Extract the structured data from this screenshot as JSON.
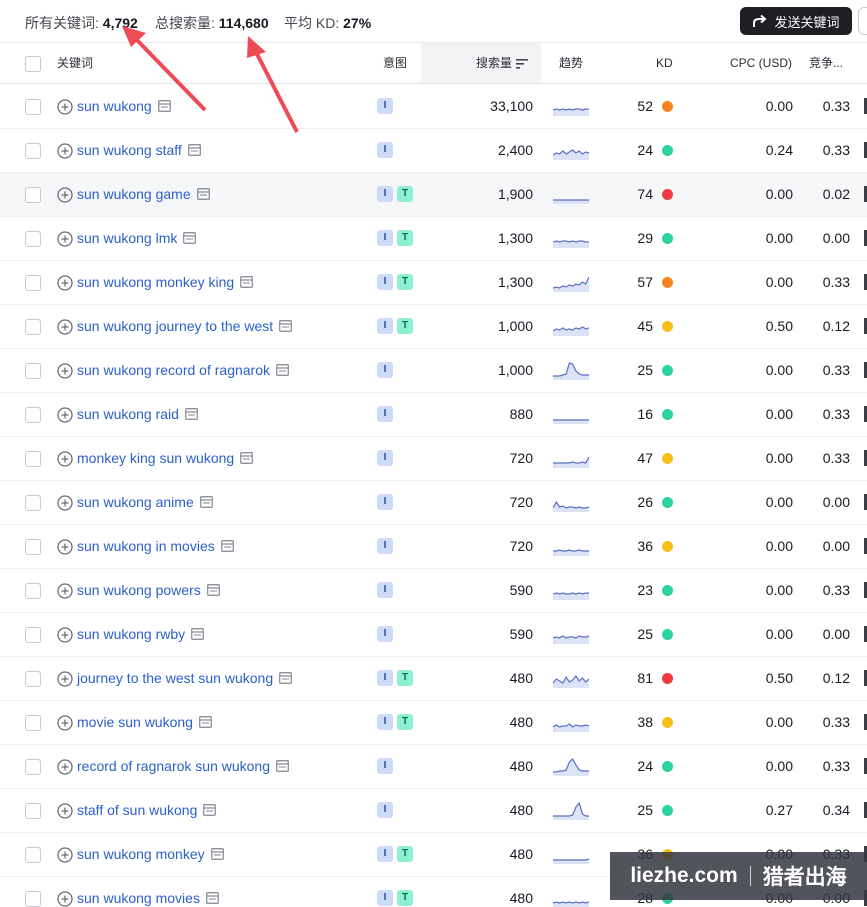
{
  "summary": {
    "all_keywords_label": "所有关键词:",
    "all_keywords_value": "4,792",
    "total_volume_label": "总搜索量:",
    "total_volume_value": "114,680",
    "avg_kd_label": "平均 KD:",
    "avg_kd_value": "27%"
  },
  "toolbar": {
    "send_label": "发送关键词"
  },
  "columns": {
    "keyword": "关键词",
    "intent": "意图",
    "volume": "搜索量",
    "trend": "趋势",
    "kd": "KD",
    "cpc": "CPC (USD)",
    "competition": "竞争..."
  },
  "colors": {
    "kd_orange": "#f5831f",
    "kd_green": "#2ed19f",
    "kd_red": "#ef3b3f",
    "kd_yellow": "#f7be1c",
    "link": "#2c60c9"
  },
  "rows": [
    {
      "keyword": "sun wukong",
      "intents": [
        "I"
      ],
      "volume": "33,100",
      "kd": "52",
      "kd_color": "#f5831f",
      "cpc": "0.00",
      "comp": "0.33",
      "trend": [
        5,
        6,
        5,
        6,
        5,
        6,
        5,
        6,
        6,
        5,
        6,
        6
      ]
    },
    {
      "keyword": "sun wukong staff",
      "intents": [
        "I"
      ],
      "volume": "2,400",
      "kd": "24",
      "kd_color": "#2ed19f",
      "cpc": "0.24",
      "comp": "0.33",
      "trend": [
        4,
        6,
        5,
        8,
        5,
        7,
        9,
        6,
        8,
        5,
        7,
        6
      ]
    },
    {
      "keyword": "sun wukong game",
      "intents": [
        "I",
        "T"
      ],
      "volume": "1,900",
      "kd": "74",
      "kd_color": "#ef3b3f",
      "cpc": "0.00",
      "comp": "0.02",
      "trend": [
        3,
        3,
        3,
        3,
        3,
        3,
        3,
        3,
        3,
        3,
        3,
        3
      ]
    },
    {
      "keyword": "sun wukong lmk",
      "intents": [
        "I",
        "T"
      ],
      "volume": "1,300",
      "kd": "29",
      "kd_color": "#2ed19f",
      "cpc": "0.00",
      "comp": "0.00",
      "trend": [
        5,
        6,
        5,
        6,
        6,
        5,
        6,
        5,
        6,
        6,
        5,
        5
      ]
    },
    {
      "keyword": "sun wukong monkey king",
      "intents": [
        "I",
        "T"
      ],
      "volume": "1,300",
      "kd": "57",
      "kd_color": "#f5831f",
      "cpc": "0.00",
      "comp": "0.33",
      "trend": [
        3,
        4,
        3,
        5,
        4,
        6,
        5,
        7,
        6,
        9,
        7,
        14
      ]
    },
    {
      "keyword": "sun wukong journey to the west",
      "intents": [
        "I",
        "T"
      ],
      "volume": "1,000",
      "kd": "45",
      "kd_color": "#f7be1c",
      "cpc": "0.50",
      "comp": "0.12",
      "trend": [
        4,
        6,
        5,
        7,
        5,
        6,
        5,
        7,
        6,
        8,
        6,
        7
      ]
    },
    {
      "keyword": "sun wukong record of ragnarok",
      "intents": [
        "I"
      ],
      "volume": "1,000",
      "kd": "25",
      "kd_color": "#2ed19f",
      "cpc": "0.00",
      "comp": "0.33",
      "trend": [
        3,
        3,
        3,
        4,
        5,
        16,
        15,
        8,
        5,
        4,
        4,
        4
      ]
    },
    {
      "keyword": "sun wukong raid",
      "intents": [
        "I"
      ],
      "volume": "880",
      "kd": "16",
      "kd_color": "#2ed19f",
      "cpc": "0.00",
      "comp": "0.33",
      "trend": [
        3,
        3,
        3,
        3,
        3,
        3,
        3,
        3,
        3,
        3,
        3,
        3
      ]
    },
    {
      "keyword": "monkey king sun wukong",
      "intents": [
        "I"
      ],
      "volume": "720",
      "kd": "47",
      "kd_color": "#f7be1c",
      "cpc": "0.00",
      "comp": "0.33",
      "trend": [
        4,
        4,
        4,
        4,
        4,
        4,
        5,
        4,
        4,
        5,
        4,
        10
      ]
    },
    {
      "keyword": "sun wukong anime",
      "intents": [
        "I"
      ],
      "volume": "720",
      "kd": "26",
      "kd_color": "#2ed19f",
      "cpc": "0.00",
      "comp": "0.00",
      "trend": [
        3,
        9,
        4,
        5,
        3,
        4,
        4,
        3,
        4,
        3,
        3,
        4
      ]
    },
    {
      "keyword": "sun wukong in movies",
      "intents": [
        "I"
      ],
      "volume": "720",
      "kd": "36",
      "kd_color": "#f7be1c",
      "cpc": "0.00",
      "comp": "0.00",
      "trend": [
        4,
        4,
        5,
        4,
        4,
        5,
        4,
        4,
        5,
        4,
        4,
        4
      ]
    },
    {
      "keyword": "sun wukong powers",
      "intents": [
        "I"
      ],
      "volume": "590",
      "kd": "23",
      "kd_color": "#2ed19f",
      "cpc": "0.00",
      "comp": "0.33",
      "trend": [
        5,
        6,
        5,
        6,
        5,
        5,
        6,
        5,
        6,
        5,
        6,
        6
      ]
    },
    {
      "keyword": "sun wukong rwby",
      "intents": [
        "I"
      ],
      "volume": "590",
      "kd": "25",
      "kd_color": "#2ed19f",
      "cpc": "0.00",
      "comp": "0.00",
      "trend": [
        5,
        6,
        5,
        7,
        5,
        6,
        6,
        5,
        7,
        6,
        6,
        7
      ]
    },
    {
      "keyword": "journey to the west sun wukong",
      "intents": [
        "I",
        "T"
      ],
      "volume": "480",
      "kd": "81",
      "kd_color": "#ef3b3f",
      "cpc": "0.50",
      "comp": "0.12",
      "trend": [
        4,
        8,
        6,
        4,
        10,
        5,
        7,
        11,
        6,
        9,
        5,
        8
      ]
    },
    {
      "keyword": "movie sun wukong",
      "intents": [
        "I",
        "T"
      ],
      "volume": "480",
      "kd": "38",
      "kd_color": "#f7be1c",
      "cpc": "0.00",
      "comp": "0.33",
      "trend": [
        4,
        6,
        4,
        5,
        5,
        7,
        4,
        6,
        5,
        5,
        6,
        5
      ]
    },
    {
      "keyword": "record of ragnarok sun wukong",
      "intents": [
        "I"
      ],
      "volume": "480",
      "kd": "24",
      "kd_color": "#2ed19f",
      "cpc": "0.00",
      "comp": "0.33",
      "trend": [
        3,
        3,
        4,
        4,
        5,
        13,
        16,
        10,
        5,
        4,
        4,
        4
      ]
    },
    {
      "keyword": "staff of sun wukong",
      "intents": [
        "I"
      ],
      "volume": "480",
      "kd": "25",
      "kd_color": "#2ed19f",
      "cpc": "0.27",
      "comp": "0.34",
      "trend": [
        3,
        3,
        3,
        3,
        3,
        3,
        4,
        12,
        16,
        5,
        3,
        3
      ]
    },
    {
      "keyword": "sun wukong monkey",
      "intents": [
        "I",
        "T"
      ],
      "volume": "480",
      "kd": "36",
      "kd_color": "#f7be1c",
      "cpc": "0.00",
      "comp": "0.33",
      "trend": [
        3,
        3,
        3,
        3,
        3,
        3,
        3,
        3,
        3,
        3,
        3,
        4
      ]
    },
    {
      "keyword": "sun wukong movies",
      "intents": [
        "I",
        "T"
      ],
      "volume": "480",
      "kd": "28",
      "kd_color": "#2ed19f",
      "cpc": "0.00",
      "comp": "0.00",
      "trend": [
        4,
        5,
        4,
        5,
        4,
        5,
        4,
        5,
        4,
        5,
        4,
        5
      ]
    }
  ],
  "watermark": {
    "site": "liezhe.com",
    "name": "猎者出海"
  }
}
